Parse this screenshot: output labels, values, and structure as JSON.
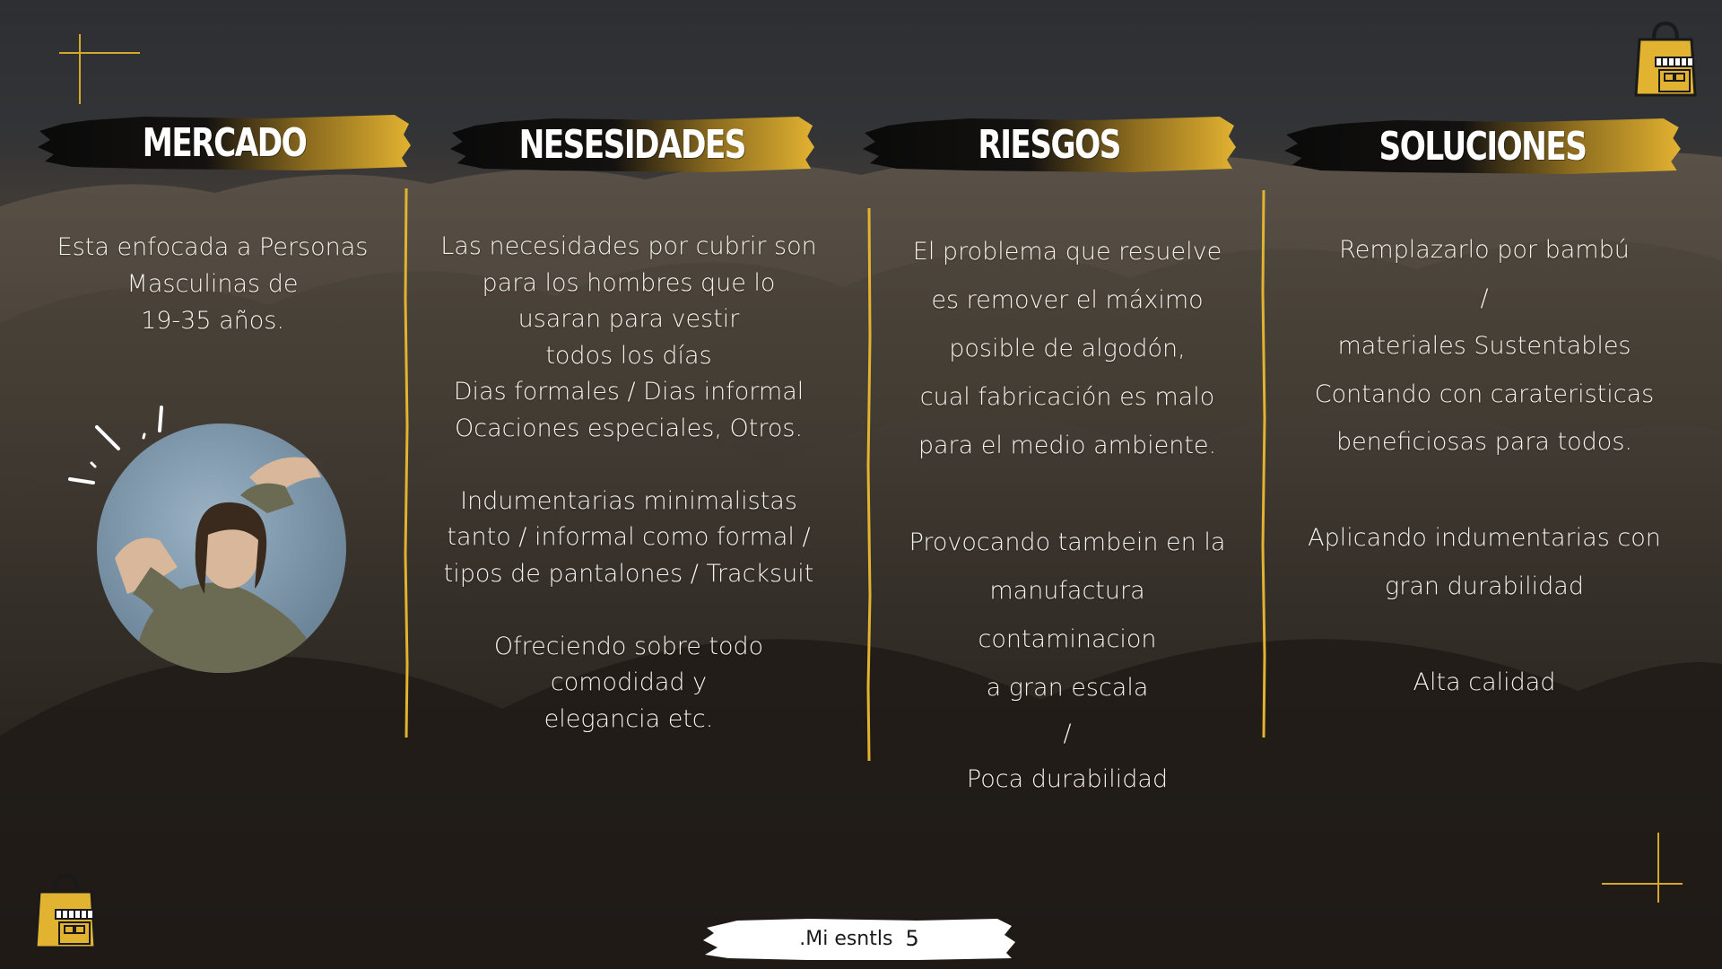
{
  "colors": {
    "accent": "#E2B231",
    "ink": "#0c0c0c",
    "text": "#f4f1ec"
  },
  "icons": {
    "store_bag": "shopping-bag-storefront-icon",
    "cross": "plus-cross-icon"
  },
  "headers": {
    "mercado": "MERCADO",
    "necesidades": "NESESIDADES",
    "riesgos": "RIESGOS",
    "soluciones": "SOLUCIONES"
  },
  "mercado": {
    "lines": [
      "Esta enfocada a Personas",
      "Masculinas de",
      "19-35 años."
    ]
  },
  "necesidades": {
    "p1": [
      "Las necesidades por cubrir son",
      "para los hombres que lo",
      "usaran para vestir",
      "todos los días",
      "Dias formales / Dias informal",
      "Ocaciones especiales, Otros."
    ],
    "p2": [
      "Indumentarias minimalistas",
      "tanto / informal como formal /",
      "tipos de pantalones / Tracksuit"
    ],
    "p3": [
      "Ofreciendo sobre todo",
      "comodidad y",
      "elegancia etc."
    ]
  },
  "riesgos": {
    "p1": [
      "El problema que resuelve",
      "es remover el máximo",
      "posible de algodón,",
      "cual fabricación es malo",
      "para el medio ambiente."
    ],
    "p2": [
      "Provocando tambein en la",
      "manufactura",
      "contaminacion",
      "a gran escala",
      "/",
      "Poca durabilidad"
    ]
  },
  "soluciones": {
    "p1": [
      "Remplazarlo por bambú",
      "/",
      "materiales Sustentables",
      "Contando con carateristicas",
      "beneficiosas para todos."
    ],
    "p2": [
      "Aplicando indumentarias con",
      "gran durabilidad"
    ],
    "p3": [
      "Alta calidad"
    ]
  },
  "footer": {
    "brand": ".Mi esntls",
    "page": "5"
  }
}
